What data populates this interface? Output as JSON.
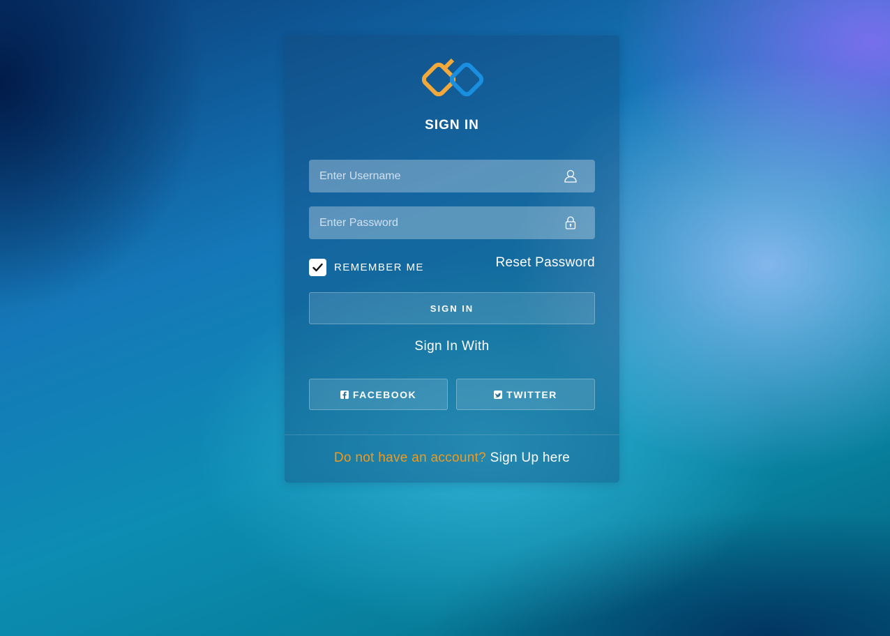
{
  "colors": {
    "accent_orange": "#f29a1c",
    "logo_orange": "#f2a93b",
    "logo_blue": "#1a8fe0"
  },
  "logo": {
    "icon": "chain-link-logo-icon"
  },
  "header": {
    "title": "SIGN IN"
  },
  "form": {
    "username_placeholder": "Enter Username",
    "username_value": "",
    "username_icon": "user-icon",
    "password_placeholder": "Enter Password",
    "password_value": "",
    "password_icon": "lock-icon",
    "remember_checked": true,
    "remember_label": "REMEMBER ME",
    "reset_label": "Reset Password",
    "submit_label": "SIGN IN"
  },
  "social": {
    "heading": "Sign In With",
    "facebook_label": "FACEBOOK",
    "facebook_icon": "facebook-icon",
    "twitter_label": "TWITTER",
    "twitter_icon": "twitter-icon"
  },
  "footer": {
    "question": "Do not have an account?",
    "signup_label": "Sign Up here"
  }
}
